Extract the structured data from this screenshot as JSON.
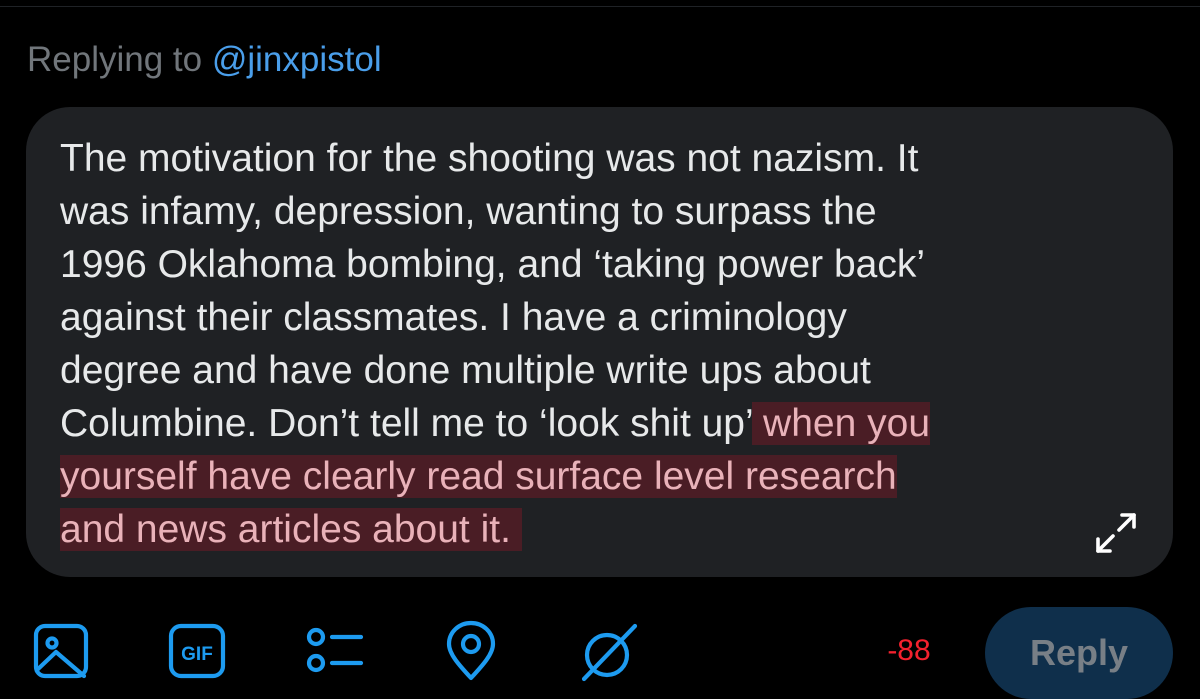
{
  "header": {
    "replying_to_label": "Replying to",
    "handle": "@jinxpistol"
  },
  "compose": {
    "text_within_limit": "The motivation for the shooting was not nazism. It\nwas infamy, depression, wanting to surpass the\n1996 Oklahoma bombing, and ‘taking power back’\nagainst their classmates. I have a criminology\ndegree and have done multiple write ups about\nColumbine. Don’t tell me to ‘look shit up’",
    "text_over_limit": " when you\nyourself have clearly read surface level research\nand news articles about it. ",
    "expand_icon": "expand-arrows-icon"
  },
  "toolbar": {
    "icons": [
      "image-icon",
      "gif-icon",
      "poll-icon",
      "location-icon",
      "schedule-disabled-icon"
    ],
    "char_count": "-88",
    "reply_label": "Reply"
  },
  "colors": {
    "background": "#000000",
    "compose_bg": "#1f2124",
    "text": "#e7e9ea",
    "muted": "#71767b",
    "accent": "#4a9eea",
    "overflow_bg": "#4a1d25",
    "overflow_text": "#e9b2b9",
    "counter_negative": "#f4212e",
    "reply_button_bg": "#0f2f4b",
    "reply_button_text": "#787f86"
  }
}
